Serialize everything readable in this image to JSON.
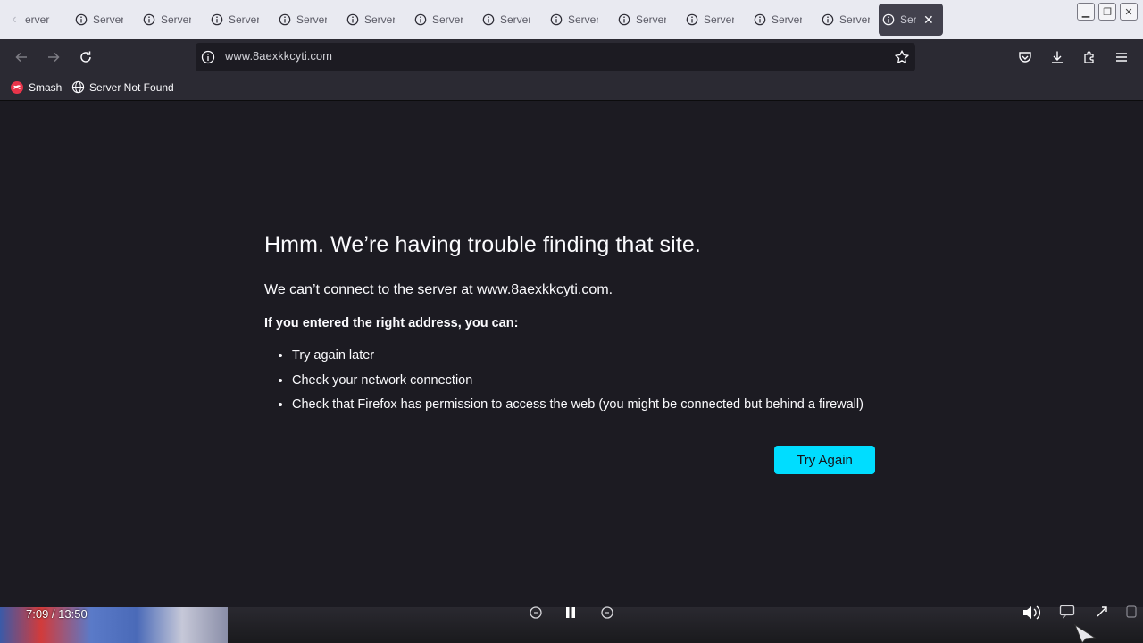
{
  "tabs": [
    {
      "label": "erver",
      "active": false
    },
    {
      "label": "Server",
      "active": false
    },
    {
      "label": "Server",
      "active": false
    },
    {
      "label": "Server",
      "active": false
    },
    {
      "label": "Server",
      "active": false
    },
    {
      "label": "Server",
      "active": false
    },
    {
      "label": "Server",
      "active": false
    },
    {
      "label": "Server",
      "active": false
    },
    {
      "label": "Server",
      "active": false
    },
    {
      "label": "Server",
      "active": false
    },
    {
      "label": "Server",
      "active": false
    },
    {
      "label": "Server",
      "active": false
    },
    {
      "label": "Ser",
      "active": true
    }
  ],
  "navbar": {
    "url": "www.8aexkkcyti.com",
    "icons": [
      "back-icon",
      "forward-icon",
      "reload-icon",
      "info-icon",
      "star-icon",
      "pocket-icon",
      "download-icon",
      "extensions-icon",
      "menu-icon"
    ]
  },
  "bookmarks": [
    {
      "label": "Smash",
      "icon": "smash-icon"
    },
    {
      "label": "Server Not Found",
      "icon": "globe-icon"
    }
  ],
  "error": {
    "title": "Hmm. We’re having trouble finding that site.",
    "description": "We can’t connect to the server at www.8aexkkcyti.com.",
    "subtitle": "If you entered the right address, you can:",
    "suggestions": [
      "Try again later",
      "Check your network connection",
      "Check that Firefox has permission to access the web (you might be connected but behind a firewall)"
    ],
    "button_label": "Try Again",
    "button_color": "#00ddff"
  },
  "video": {
    "time": "7:09 / 13:50"
  },
  "colors": {
    "background": "#1c1b22",
    "toolbar": "#2b2a33",
    "tabstrip": "#e9eaf1",
    "accent": "#00ddff"
  }
}
